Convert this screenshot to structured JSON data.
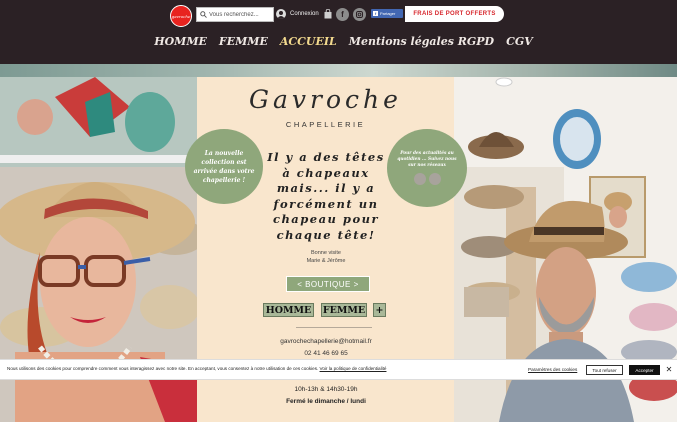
{
  "header": {
    "logo_text": "gavroche",
    "search_placeholder": "Vous recherchez...",
    "login_label": "Connexion",
    "share_label": "Partager",
    "shipping_banner": "FRAIS DE PORT OFFERTS",
    "accent_color": "#f2d98e",
    "background_color": "#2b2125"
  },
  "nav": {
    "items": [
      {
        "label": "HOMME"
      },
      {
        "label": "FEMME"
      },
      {
        "label": "ACCUEIL",
        "active": true
      },
      {
        "label": "Mentions légales RGPD"
      },
      {
        "label": "CGV"
      }
    ]
  },
  "main": {
    "brand": "Gavroche",
    "subbrand": "CHAPELLERIE",
    "bubble_left": "La nouvelle collection est arrivée dans votre chapellerie !",
    "bubble_right": "Pour des actualités au quotidien ... Suivez nous sur nos réseaux",
    "tagline": "Il y a des têtes à chapeaux mais... il y a forcément un chapeau pour chaque tête!",
    "sign_line1": "Bonne visite",
    "sign_line2": "Marie & Jérôme",
    "boutique_button": "< BOUTIQUE >",
    "cat_homme": "HOMME",
    "cat_femme": "FEMME",
    "cat_plus": "+",
    "email": "gavrochechapellerie@hotmail.fr",
    "phone": "02 41 46 69 65",
    "hours": "10h-13h & 14h30-19h",
    "closed": "Fermé le dimanche / lundi",
    "panel_color": "#f9e6cd",
    "bubble_color": "#8fa77b"
  },
  "cookie": {
    "text": "Nous utilisons des cookies pour comprendre comment vous interagissez avec notre site. En acceptant, vous consentez à notre utilisation de ces cookies.",
    "policy_link": "Voir la politique de confidentialité",
    "preferences": "Paramètres des cookies",
    "refuse": "Tout refuser",
    "accept": "Accepter",
    "close": "✕"
  }
}
